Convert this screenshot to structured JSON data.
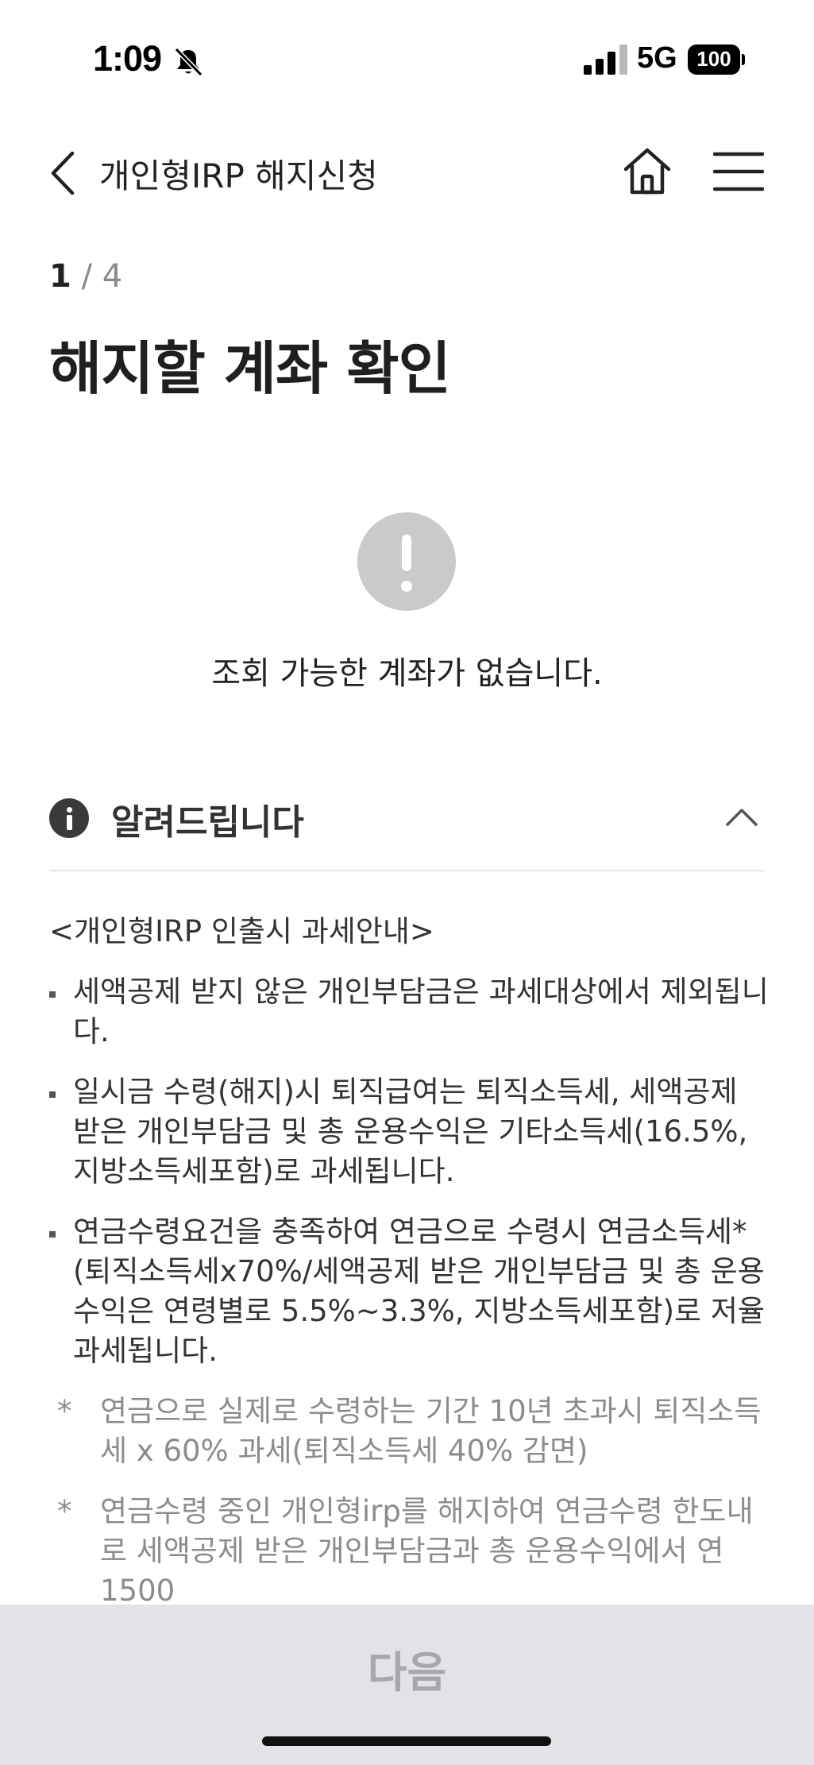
{
  "status_bar": {
    "time": "1:09",
    "network": "5G",
    "battery": "100",
    "silent_icon": "bell-slash-icon",
    "signal_icon": "signal-bars-icon"
  },
  "header": {
    "title": "개인형IRP 해지신청",
    "back_icon": "chevron-left-icon",
    "home_icon": "home-icon",
    "menu_icon": "hamburger-menu-icon"
  },
  "step": {
    "current": "1",
    "separator_total": "/ 4"
  },
  "page_title": "해지할 계좌 확인",
  "empty_state": {
    "icon": "exclamation-circle-icon",
    "message": "조회 가능한 계좌가 없습니다."
  },
  "notice": {
    "icon": "info-circle-icon",
    "title": "알려드립니다",
    "toggle_icon": "chevron-up-icon",
    "subheading": "<개인형IRP 인출시 과세안내>",
    "bullets": [
      "세액공제 받지 않은 개인부담금은 과세대상에서 제외됩니다.",
      "일시금 수령(해지)시 퇴직급여는 퇴직소득세, 세액공제 받은 개인부담금 및 총 운용수익은 기타소득세(16.5%, 지방소득세포함)로 과세됩니다.",
      "연금수령요건을 충족하여 연금으로 수령시 연금소득세*(퇴직소득세x70%/세액공제 받은 개인부담금 및 총 운용수익은 연령별로 5.5%~3.3%, 지방소득세포함)로 저율과세됩니다."
    ],
    "notes": [
      {
        "mark": "*",
        "text": "연금으로 실제로 수령하는 기간 10년 초과시 퇴직소득세 x 60% 과세(퇴직소득세 40% 감면)"
      },
      {
        "mark": "*",
        "text": "연금수령 중인 개인형irp를 해지하여 연금수령 한도내로 세액공제 받은 개인부담금과 총 운용수익에서 연 1500"
      }
    ]
  },
  "footer": {
    "next_label": "다음"
  },
  "colors": {
    "accent_disabled": "#a5a7aa",
    "footer_bg": "#e1e3e6",
    "empty_icon": "#c9cacc",
    "note_text": "#8c8c8c"
  }
}
